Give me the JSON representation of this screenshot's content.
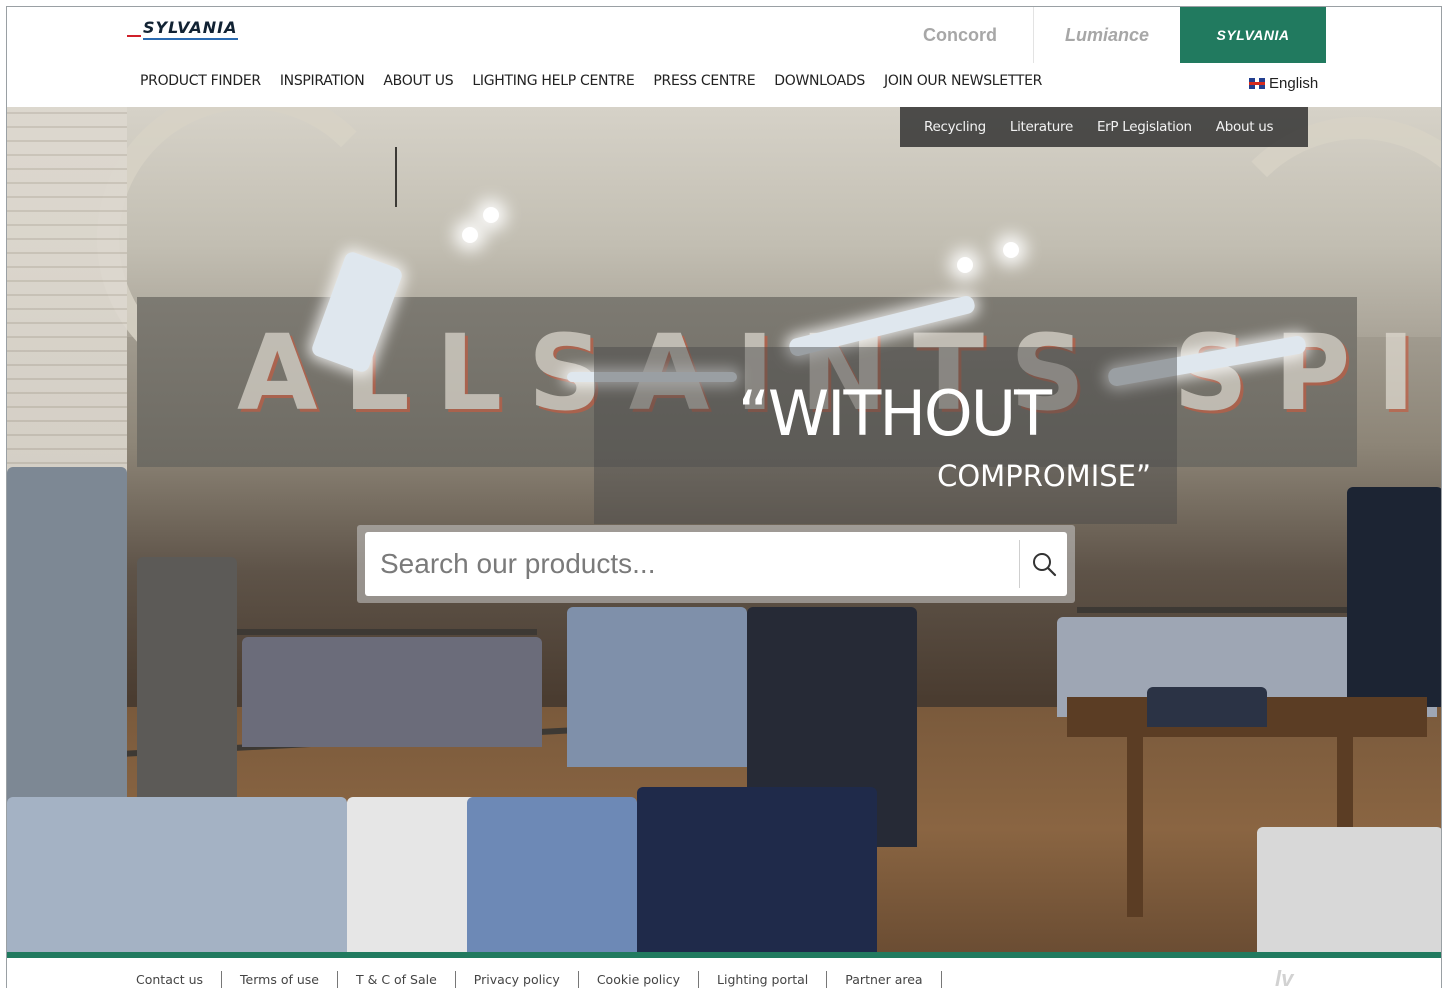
{
  "header": {
    "logo_text": "SYLVANIA",
    "brands": [
      "Concord",
      "Lumiance",
      "SYLVANIA"
    ],
    "nav": [
      "PRODUCT FINDER",
      "INSPIRATION",
      "ABOUT US",
      "LIGHTING HELP CENTRE",
      "PRESS CENTRE",
      "DOWNLOADS",
      "JOIN OUR NEWSLETTER"
    ],
    "language": "English"
  },
  "subnav": [
    "Recycling",
    "Literature",
    "ErP Legislation",
    "About us"
  ],
  "hero": {
    "quote_line1": "“WITHOUT",
    "quote_line2": "COMPROMISE”"
  },
  "search": {
    "placeholder": "Search our products..."
  },
  "footer": {
    "links": [
      "Contact us",
      "Terms of use",
      "T & C of Sale",
      "Privacy policy",
      "Cookie policy",
      "Lighting portal",
      "Partner area"
    ],
    "mark": "lv"
  },
  "colors": {
    "brand_green": "#217a5f"
  },
  "icons": [
    "search-icon",
    "uk-flag-icon"
  ]
}
